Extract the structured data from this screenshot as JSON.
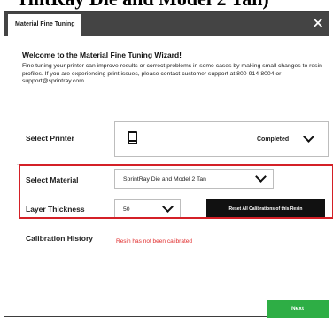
{
  "background_text": "rintRay Die and Model 2 Tan)",
  "dialog": {
    "title": "Material Fine Tuning",
    "close_symbol": "✕"
  },
  "wizard": {
    "welcome": "Welcome to the Material Fine Tuning Wizard!",
    "intro": "Fine tuning your printer can improve results or correct problems in some cases by making small changes to resin profiles. If you are experiencing print issues, please contact customer support at 800-914-8004 or support@sprintray.com."
  },
  "printer": {
    "label": "Select Printer",
    "status": "Completed",
    "icon": "printer-device-icon"
  },
  "material": {
    "label": "Select Material",
    "selected": "SprintRay Die and Model 2 Tan"
  },
  "thickness": {
    "label": "Layer Thickness",
    "selected": "50"
  },
  "reset_button": "Reset All Calibrations of this Resin",
  "calibration": {
    "label": "Calibration History",
    "status": "Resin has not been calibrated"
  },
  "footer": {
    "next_label": "Next"
  },
  "colors": {
    "titlebar": "#444444",
    "highlight": "#d42027",
    "next_button": "#2eae45",
    "reset_button": "#111111",
    "calibration_status": "#e02b2b"
  }
}
